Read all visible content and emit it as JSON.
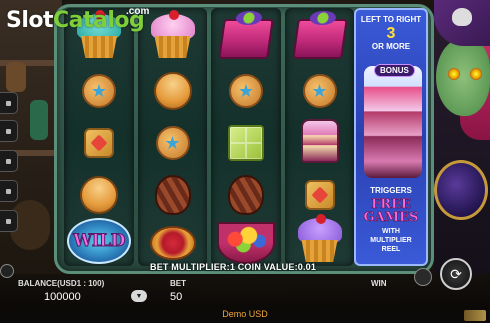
{
  "logo": {
    "slot": "Slot",
    "catalog": "Catalog",
    "dotcom": ".com"
  },
  "reels": [
    [
      "cupcake-teal",
      "cookie-star",
      "square-cookie",
      "swirl-orange",
      "wild"
    ],
    [
      "cupcake-pink",
      "swirl-orange",
      "cookie-star",
      "chocolate",
      "fruit-tart"
    ],
    [
      "treat-box",
      "cookie-star",
      "jelly-square",
      "chocolate",
      "fruit-bowl"
    ],
    [
      "treat-box",
      "cookie-star",
      "cake-slice",
      "square-cookie",
      "cupcake-purple"
    ]
  ],
  "wild_label": "WILD",
  "info_panel": {
    "line1": "LEFT TO RIGHT",
    "count": "3",
    "line2": "OR MORE",
    "bonus": "BONUS",
    "triggers": "TRIGGERS",
    "free_games_1": "FREE",
    "free_games_2": "GAMES",
    "with_1": "WITH",
    "with_2": "MULTIPLIER",
    "with_3": "REEL"
  },
  "multiplier_line": "BET MULTIPLIER:1 COIN VALUE:0.01",
  "balance": {
    "label": "BALANCE(USD1 : 100)",
    "value": "100000"
  },
  "bet": {
    "label": "BET",
    "value": "50"
  },
  "win": {
    "label": "WIN",
    "value": ""
  },
  "footer": {
    "demo": "Demo USD"
  },
  "colors": {
    "accent": "#f0a63a",
    "panel": "#2a40b0",
    "frame": "#2a4a40"
  }
}
